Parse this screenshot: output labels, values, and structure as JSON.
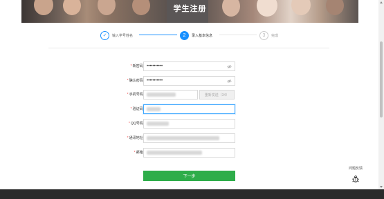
{
  "banner": {
    "title": "学生注册"
  },
  "steps": [
    {
      "num": "✓",
      "label": "输入学号姓名"
    },
    {
      "num": "2",
      "label": "录入基本信息"
    },
    {
      "num": "3",
      "label": "完成"
    }
  ],
  "form": {
    "new_password": {
      "label": "新密码:",
      "value": "•••••••••••"
    },
    "confirm_password": {
      "label": "确认密码:",
      "value": "•••••••••••"
    },
    "phone": {
      "label": "手机号码:",
      "code_button": "重新发送（34）"
    },
    "verify_code": {
      "label": "验证码:"
    },
    "qq": {
      "label": "QQ号码:"
    },
    "address": {
      "label": "通讯地址:"
    },
    "email": {
      "label": "邮箱:"
    }
  },
  "next_button": "下一步",
  "feedback": {
    "label": "问题反馈",
    "icon": "bug-icon"
  },
  "colors": {
    "primary": "#1890ff",
    "next": "#2ead4a",
    "required": "#e44444"
  }
}
